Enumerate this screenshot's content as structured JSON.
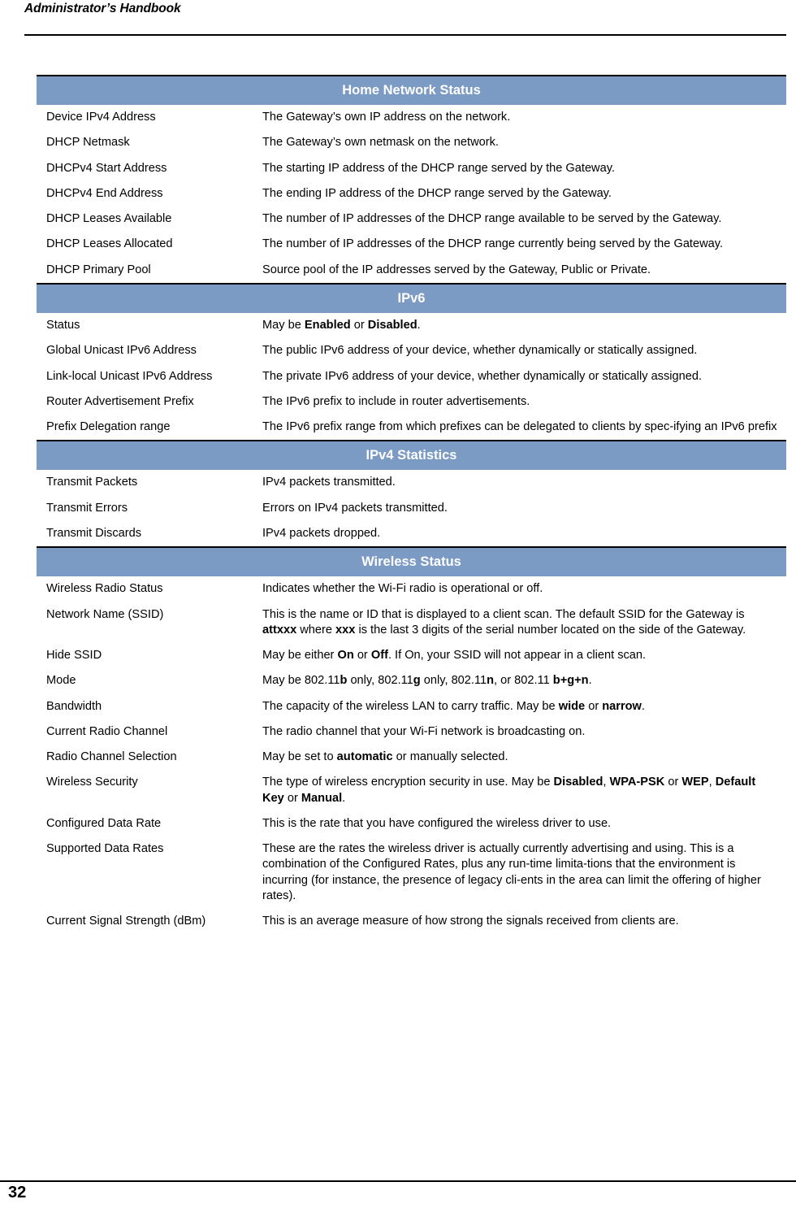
{
  "running_head": "Administrator’s Handbook",
  "page_number": "32",
  "colors": {
    "section_header_background": "#7b9ac4",
    "section_header_text": "#ffffff",
    "rule": "#000000",
    "body_text": "#000000"
  },
  "table": {
    "sections": [
      {
        "title": "Home Network Status",
        "rows": [
          {
            "label": "Device IPv4 Address",
            "desc": [
              {
                "text": "The Gateway’s own IP address on the network.",
                "bold": false
              }
            ]
          },
          {
            "label": "DHCP Netmask",
            "desc": [
              {
                "text": "The Gateway’s own netmask on the network.",
                "bold": false
              }
            ]
          },
          {
            "label": "DHCPv4 Start Address",
            "desc": [
              {
                "text": "The starting IP address of the DHCP range served by the Gateway.",
                "bold": false
              }
            ]
          },
          {
            "label": "DHCPv4 End Address",
            "desc": [
              {
                "text": "The ending IP address of the DHCP range served by the Gateway.",
                "bold": false
              }
            ]
          },
          {
            "label": "DHCP Leases Available",
            "desc": [
              {
                "text": "The number of IP addresses of the DHCP range available to be served by the Gateway.",
                "bold": false
              }
            ]
          },
          {
            "label": "DHCP Leases Allocated",
            "desc": [
              {
                "text": "The number of IP addresses of the DHCP range currently being served by the Gateway.",
                "bold": false
              }
            ]
          },
          {
            "label": "DHCP Primary Pool",
            "desc": [
              {
                "text": "Source pool of the IP addresses served by the Gateway, Public or Private.",
                "bold": false
              }
            ]
          }
        ]
      },
      {
        "title": "IPv6",
        "rows": [
          {
            "label": "Status",
            "desc": [
              {
                "text": "May be ",
                "bold": false
              },
              {
                "text": "Enabled",
                "bold": true
              },
              {
                "text": " or ",
                "bold": false
              },
              {
                "text": "Disabled",
                "bold": true
              },
              {
                "text": ".",
                "bold": false
              }
            ]
          },
          {
            "label": "Global Unicast IPv6 Address",
            "desc": [
              {
                "text": "The public IPv6 address of your device, whether dynamically or statically assigned.",
                "bold": false
              }
            ]
          },
          {
            "label": "Link-local Unicast IPv6 Address",
            "desc": [
              {
                "text": "The private IPv6 address of your device, whether dynamically or statically assigned.",
                "bold": false
              }
            ]
          },
          {
            "label": "Router Advertisement Prefix",
            "desc": [
              {
                "text": "The IPv6 prefix to include in router advertisements.",
                "bold": false
              }
            ]
          },
          {
            "label": "Prefix Delegation range",
            "desc": [
              {
                "text": "The IPv6 prefix range from which prefixes can be delegated to clients by spec-ifying an IPv6 prefix",
                "bold": false
              }
            ]
          }
        ]
      },
      {
        "title": "IPv4 Statistics",
        "rows": [
          {
            "label": "Transmit Packets",
            "desc": [
              {
                "text": "IPv4 packets transmitted.",
                "bold": false
              }
            ]
          },
          {
            "label": "Transmit Errors",
            "desc": [
              {
                "text": "Errors on IPv4 packets transmitted.",
                "bold": false
              }
            ]
          },
          {
            "label": "Transmit Discards",
            "desc": [
              {
                "text": "IPv4 packets dropped.",
                "bold": false
              }
            ]
          }
        ]
      },
      {
        "title": "Wireless Status",
        "rows": [
          {
            "label": "Wireless Radio Status",
            "desc": [
              {
                "text": "Indicates whether the Wi-Fi radio is operational or off.",
                "bold": false
              }
            ]
          },
          {
            "label": "Network Name (SSID)",
            "desc": [
              {
                "text": "This is the name or ID that is displayed to a client scan. The default SSID for the Gateway is ",
                "bold": false
              },
              {
                "text": "attxxx",
                "bold": true
              },
              {
                "text": " where ",
                "bold": false
              },
              {
                "text": "xxx",
                "bold": true
              },
              {
                "text": " is the last 3 digits of the serial number located on the side of the Gateway.",
                "bold": false
              }
            ]
          },
          {
            "label": "Hide SSID",
            "desc": [
              {
                "text": "May be either ",
                "bold": false
              },
              {
                "text": "On",
                "bold": true
              },
              {
                "text": " or ",
                "bold": false
              },
              {
                "text": "Off",
                "bold": true
              },
              {
                "text": ". If On, your SSID will not appear in a client scan.",
                "bold": false
              }
            ]
          },
          {
            "label": "Mode",
            "desc": [
              {
                "text": "May be 802.11",
                "bold": false
              },
              {
                "text": "b",
                "bold": true
              },
              {
                "text": " only, 802.11",
                "bold": false
              },
              {
                "text": "g",
                "bold": true
              },
              {
                "text": " only, 802.11",
                "bold": false
              },
              {
                "text": "n",
                "bold": true
              },
              {
                "text": ", or 802.11 ",
                "bold": false
              },
              {
                "text": "b+g+n",
                "bold": true
              },
              {
                "text": ".",
                "bold": false
              }
            ]
          },
          {
            "label": "Bandwidth",
            "desc": [
              {
                "text": "The capacity of the wireless LAN to carry traffic. May be ",
                "bold": false
              },
              {
                "text": "wide",
                "bold": true
              },
              {
                "text": " or ",
                "bold": false
              },
              {
                "text": "narrow",
                "bold": true
              },
              {
                "text": ".",
                "bold": false
              }
            ]
          },
          {
            "label": "Current Radio Channel",
            "desc": [
              {
                "text": "The radio channel that your Wi-Fi network is broadcasting on.",
                "bold": false
              }
            ]
          },
          {
            "label": "Radio Channel Selection",
            "desc": [
              {
                "text": "May be set to ",
                "bold": false
              },
              {
                "text": "automatic",
                "bold": true
              },
              {
                "text": " or manually selected.",
                "bold": false
              }
            ]
          },
          {
            "label": "Wireless Security",
            "desc": [
              {
                "text": "The type of wireless encryption security in use. May be ",
                "bold": false
              },
              {
                "text": "Disabled",
                "bold": true
              },
              {
                "text": ", ",
                "bold": false
              },
              {
                "text": "WPA-PSK",
                "bold": true
              },
              {
                "text": " or ",
                "bold": false
              },
              {
                "text": "WEP",
                "bold": true
              },
              {
                "text": ", ",
                "bold": false
              },
              {
                "text": "Default Key",
                "bold": true
              },
              {
                "text": " or ",
                "bold": false
              },
              {
                "text": "Manual",
                "bold": true
              },
              {
                "text": ".",
                "bold": false
              }
            ]
          },
          {
            "label": "Configured Data Rate",
            "desc": [
              {
                "text": "This is the rate that you have configured the wireless driver to use.",
                "bold": false
              }
            ]
          },
          {
            "label": "Supported Data Rates",
            "desc": [
              {
                "text": "These are the rates the wireless driver is actually currently advertising and using. This is a combination of the Configured Rates, plus any run-time limita-tions that the environment is incurring (for instance, the presence of legacy cli-ents in the area can limit the offering of higher rates).",
                "bold": false
              }
            ]
          },
          {
            "label": "Current Signal Strength (dBm)",
            "desc": [
              {
                "text": "This is an average measure of how strong the signals received from clients are.",
                "bold": false
              }
            ]
          }
        ]
      }
    ]
  }
}
